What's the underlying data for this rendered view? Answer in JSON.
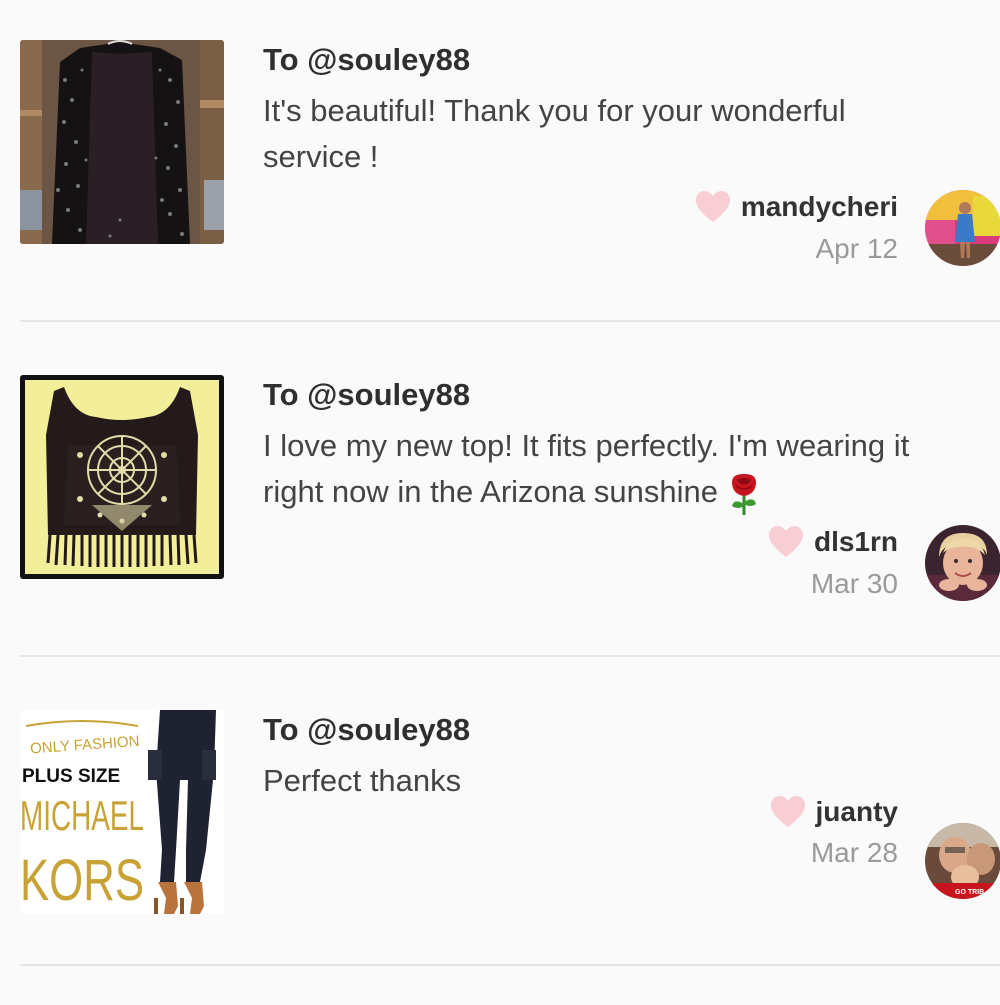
{
  "reviews": [
    {
      "to_label": "To @souley88",
      "comment_lines": [
        "It's beautiful! Thank you for your wonderful",
        "service !"
      ],
      "username": "mandycheri",
      "date": "Apr 12",
      "thumbnail": "sequin-cardigan-photo",
      "avatar": "user-avatar-photo"
    },
    {
      "to_label": "To @souley88",
      "comment_lines": [
        "I love my new top! It fits perfectly. I'm wearing it",
        "right now in the Arizona sunshine"
      ],
      "comment_emoji": "rose-emoji",
      "username": "dls1rn",
      "date": "Mar 30",
      "thumbnail": "fringe-top-photo",
      "avatar": "user-avatar-photo"
    },
    {
      "to_label": "To @souley88",
      "comment_lines": [
        "Perfect thanks"
      ],
      "username": "juanty",
      "date": "Mar 28",
      "thumbnail": "cargo-pants-ad",
      "thumbnail_text": [
        "ONLY FASHION",
        "PLUS SIZE",
        "MICHAEL",
        "KORS"
      ],
      "avatar": "user-avatar-photo",
      "avatar_text": "GO TRIB"
    }
  ],
  "colors": {
    "background": "#fbfafb",
    "heart": "#f8cdd3",
    "divider": "#e6e4e6",
    "date_text": "#9a9a9a",
    "kors_gold": "#c9a236"
  }
}
